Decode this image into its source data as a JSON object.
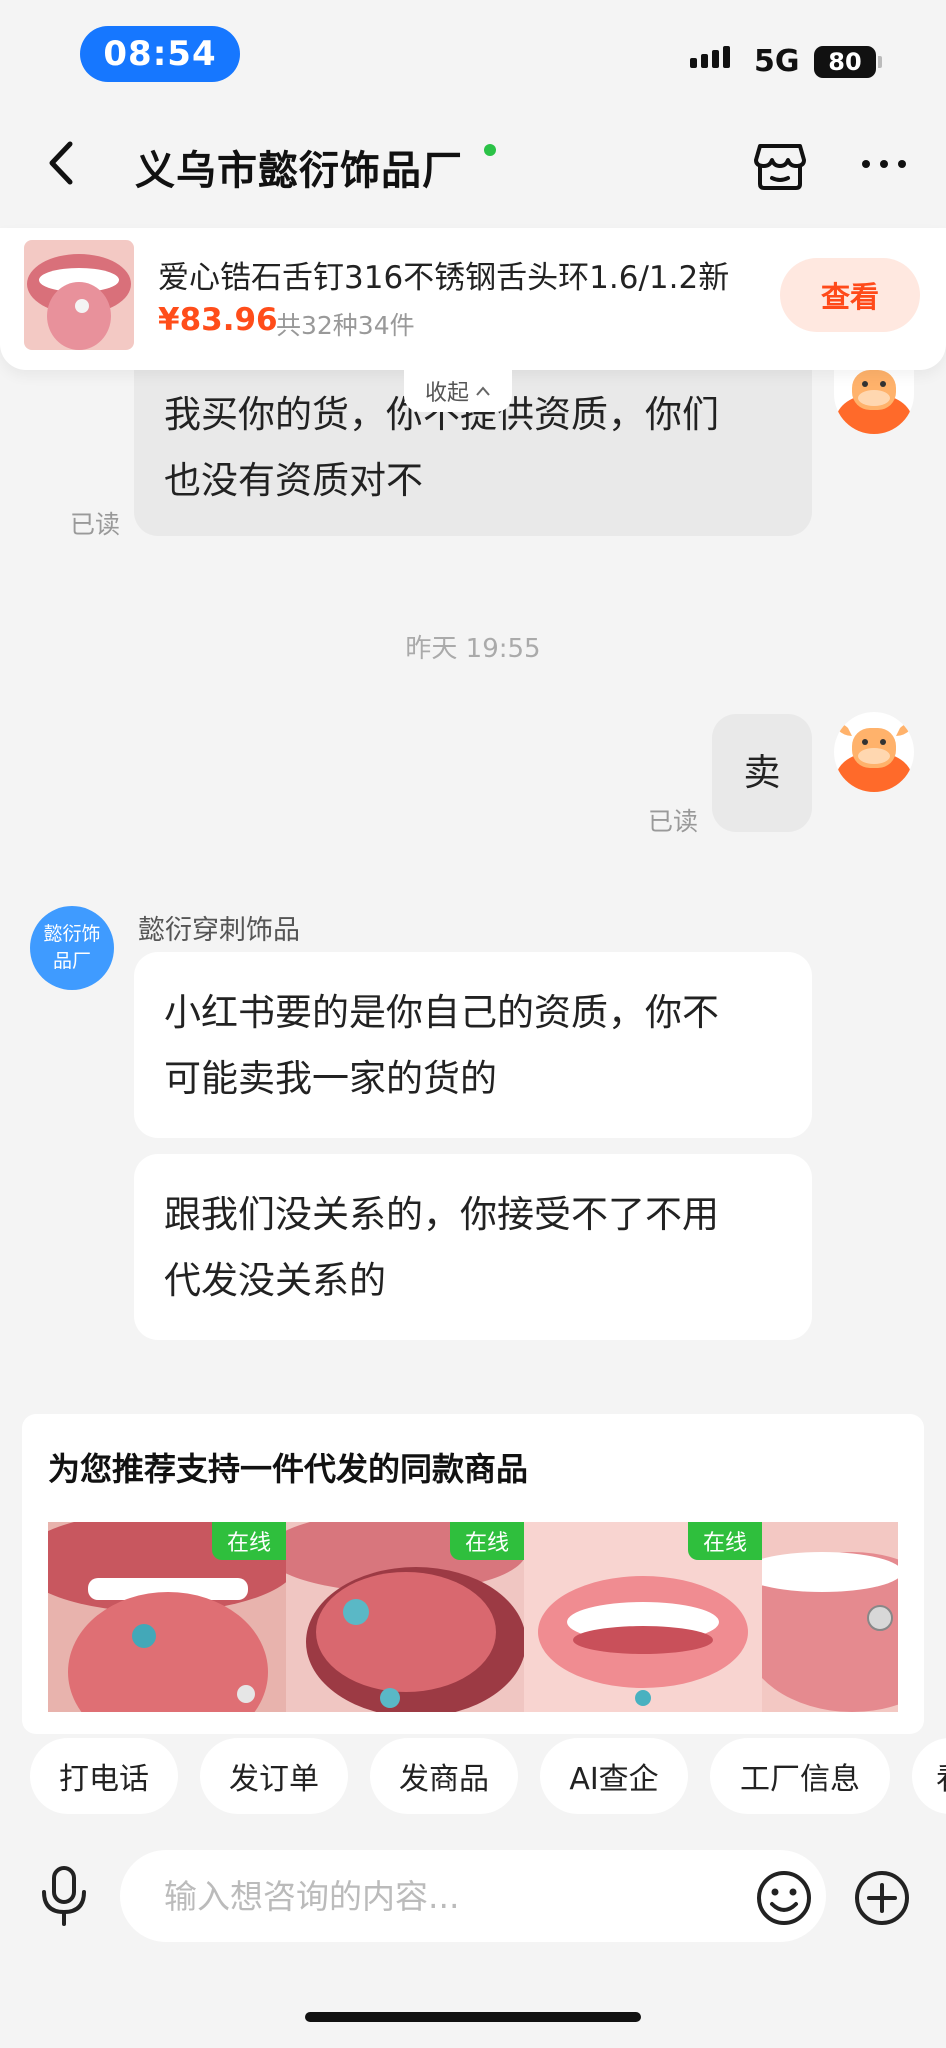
{
  "status_bar": {
    "time": "08:54",
    "network": "5G",
    "battery": "80"
  },
  "header": {
    "title": "义乌市懿衍饰品厂",
    "icons": {
      "back": "chevron-left-icon",
      "shop": "storefront-icon",
      "more": "more-dots-icon"
    }
  },
  "product": {
    "name": "爱心锆石舌钉316不锈钢舌头环1.6/1.2新",
    "price": "¥83.96",
    "count": "共32种34件",
    "view_label": "查看"
  },
  "collapse_label": "收起",
  "messages": {
    "m1_text": "我买你的货，你不提供资质，你们\n也没有资质对不",
    "m1_read": "已读",
    "divider_time": "昨天 19:55",
    "m2_text": "卖",
    "m2_read": "已读",
    "sender_name": "懿衍穿刺饰品",
    "sender_avatar_text": "懿衍饰品厂",
    "m3_text": "小红书要的是你自己的资质，你不\n可能卖我一家的货的",
    "m4_text": "跟我们没关系的，你接受不了不用\n代发没关系的"
  },
  "recommend": {
    "title": "为您推荐支持一件代发的同款商品",
    "items": [
      {
        "badge": "在线"
      },
      {
        "badge": "在线"
      },
      {
        "badge": "在线"
      },
      {
        "badge": ""
      }
    ]
  },
  "quick_actions": [
    "打电话",
    "发订单",
    "发商品",
    "AI查企",
    "工厂信息",
    "看"
  ],
  "input": {
    "placeholder": "输入想咨询的内容..."
  },
  "colors": {
    "accent": "#ff4d1a",
    "bubble_out": "#e9e9e9",
    "online_badge": "#2fbf3d",
    "time_pill": "#1677ff"
  }
}
